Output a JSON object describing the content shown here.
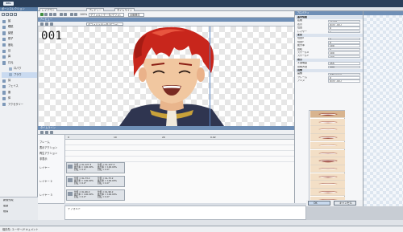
{
  "app": {
    "logo": "RPG MAKER",
    "title": "キャラクター"
  },
  "left_panel": {
    "header": "ボーンコレクション",
    "items": [
      {
        "label": "顔",
        "sub": false
      },
      {
        "label": "眼鏡",
        "sub": false
      },
      {
        "label": "髪型",
        "sub": false
      },
      {
        "label": "帽子",
        "sub": false
      },
      {
        "label": "眉毛",
        "sub": false
      },
      {
        "label": "目",
        "sub": false
      },
      {
        "label": "鼻",
        "sub": false
      },
      {
        "label": "口元",
        "sub": false
      },
      {
        "label": "口パク",
        "sub": true
      },
      {
        "label": "ブラウ",
        "sub": true,
        "selected": true
      },
      {
        "label": "耳",
        "sub": false
      },
      {
        "label": "フェイス",
        "sub": false
      },
      {
        "label": "服",
        "sub": false
      },
      {
        "label": "体",
        "sub": false
      },
      {
        "label": "アクセサリー",
        "sub": false
      }
    ],
    "bottom_items": [
      "新規作成",
      "複製",
      "削除"
    ]
  },
  "tabs": [
    "レイアウト",
    "プレビュー",
    "タイムライン"
  ],
  "toolbar": {
    "frame_label": "デフォルトテータ(デフォ)",
    "mode_label": "手動再生",
    "zoom": "100%"
  },
  "preview": {
    "header": "プレビュー",
    "frame_number": "001",
    "toolbar_label": "デフォルトテータ(デフォ)"
  },
  "timeline": {
    "header": "タイムライン",
    "ruler": [
      "0",
      "10",
      "20",
      "0.02"
    ],
    "row_names": [
      "フレーム",
      "表示アクション",
      "再生アクション",
      "非表示",
      "レイヤー",
      "レイヤー 2",
      "レイヤー 3"
    ],
    "cells": [
      {
        "lines": [
          "位置 = 0L-127.3",
          "拡大率 = 100.00%",
          "回転 = 0.0°"
        ],
        "lines2": [
          "位置 = 0L-127.3",
          "拡大率 = 100.00%",
          "回転 = 0.0°"
        ]
      },
      {
        "lines": [
          "位置 = 0L-73.2",
          "拡大率 = 100.00%",
          "回転 = 0.0°"
        ],
        "lines2": [
          "位置 = 0L-73.2",
          "拡大率 = 100.00%",
          "回転 = 0.0°"
        ]
      },
      {
        "lines": [
          "位置 = 0L-96.2",
          "拡大率 = 100.00%",
          "回転 = 0.0°"
        ],
        "lines2": [
          "位置 = 0L-96.2",
          "拡大率 = 100.00%",
          "回転 = 0.0°"
        ]
      }
    ]
  },
  "properties": {
    "header": "プロパティ",
    "rows": [
      {
        "k": "基本情報",
        "v": "",
        "sec": true
      },
      {
        "k": "名前",
        "v": "ブラウ"
      },
      {
        "k": "表示",
        "v": "表示しない"
      },
      {
        "k": "位置",
        "v": "0"
      },
      {
        "k": "レイヤー",
        "v": "1"
      },
      {
        "k": "変形",
        "v": "",
        "sec": true
      },
      {
        "k": "位置X",
        "v": "0"
      },
      {
        "k": "位置Y",
        "v": "0"
      },
      {
        "k": "拡大率",
        "v": "100"
      },
      {
        "k": "回転",
        "v": "0"
      },
      {
        "k": "スケールX",
        "v": "100"
      },
      {
        "k": "スケールY",
        "v": "100"
      },
      {
        "k": "表示",
        "v": "",
        "sec": true
      },
      {
        "k": "不透明度",
        "v": "255"
      },
      {
        "k": "合成方法",
        "v": "通常"
      },
      {
        "k": "画像",
        "v": "",
        "sec": true
      },
      {
        "k": "画像",
        "v": "表情パーツ"
      },
      {
        "k": "フレーム",
        "v": "0"
      },
      {
        "k": "アニメ",
        "v": "表示しない"
      }
    ],
    "mouth_count": 12
  },
  "bottom": {
    "input_value": "デフォルト",
    "ok": "OK",
    "cancel": "キャンセル"
  },
  "status": "保存先: ユーザー/ドキュメント",
  "colors": {
    "accent": "#6f8fb6",
    "hair": "#c8261c",
    "skin": "#f1c7a0"
  }
}
